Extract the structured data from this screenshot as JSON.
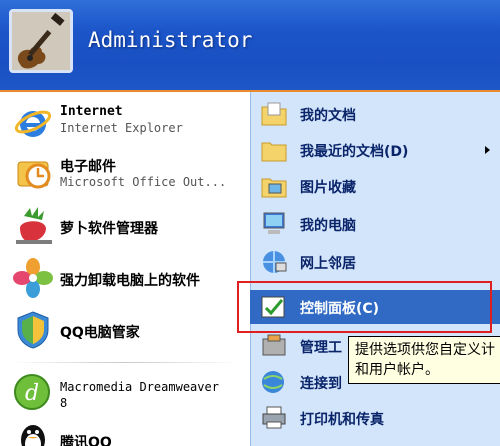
{
  "user": {
    "name": "Administrator"
  },
  "left_items": [
    {
      "title": "Internet",
      "subtitle": "Internet Explorer"
    },
    {
      "title": "电子邮件",
      "subtitle": "Microsoft Office Out..."
    },
    {
      "title": "萝卜软件管理器"
    },
    {
      "title": "强力卸载电脑上的软件"
    },
    {
      "title": "QQ电脑管家"
    },
    {
      "title": "Macromedia Dreamweaver",
      "title2": "8"
    },
    {
      "title": "腾讯QQ"
    }
  ],
  "right_items": [
    {
      "label": "我的文档"
    },
    {
      "label": "我最近的文档(D)"
    },
    {
      "label": "图片收藏"
    },
    {
      "label": "我的电脑"
    },
    {
      "label": "网上邻居"
    },
    {
      "label": "控制面板(C)"
    },
    {
      "label": "管理工"
    },
    {
      "label": "连接到"
    },
    {
      "label": "打印机和传真"
    }
  ],
  "tooltip": {
    "line1": "提供选项供您自定义计",
    "line2": "和用户帐户。"
  },
  "colors": {
    "header": "#1b55c9",
    "right_pane": "#d3e5fa",
    "highlight": "#316ac5",
    "redbox": "#e02020",
    "tooltip_bg": "#ffffe1"
  }
}
